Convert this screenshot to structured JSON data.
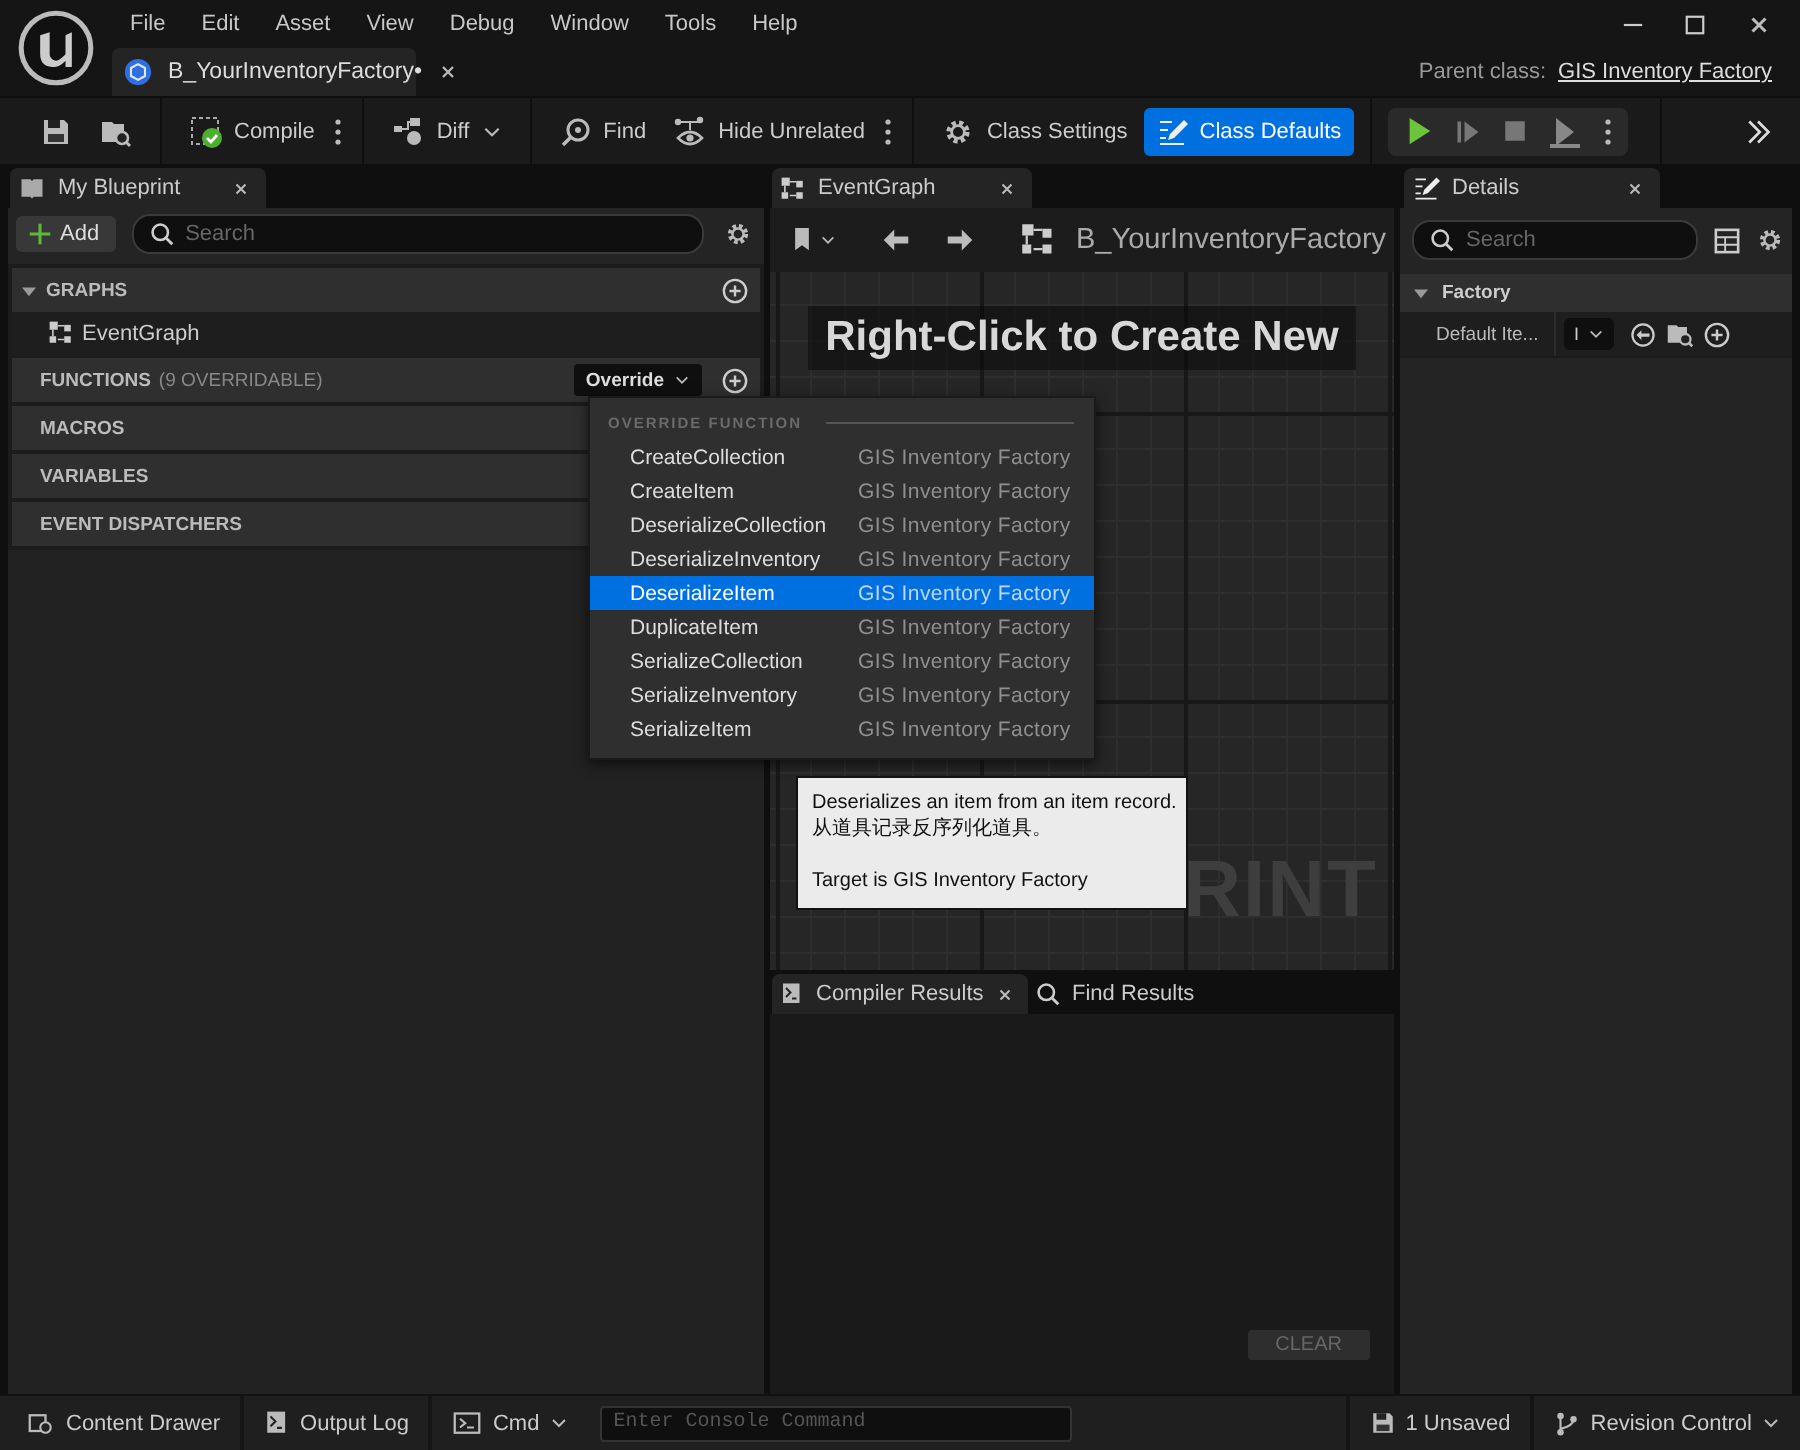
{
  "window": {
    "menu": [
      "File",
      "Edit",
      "Asset",
      "View",
      "Debug",
      "Window",
      "Tools",
      "Help"
    ],
    "document_tab": "B_YourInventoryFactory•",
    "parent_class_label": "Parent class:",
    "parent_class": "GIS Inventory Factory"
  },
  "toolbar": [
    {
      "kind": "compile",
      "label": "Compile",
      "active": false
    },
    {
      "kind": "diff",
      "label": "Diff",
      "active": false
    },
    {
      "kind": "find",
      "label": "Find",
      "active": false
    },
    {
      "kind": "hide",
      "label": "Hide Unrelated",
      "active": false
    },
    {
      "kind": "settings",
      "label": "Class Settings",
      "active": false
    },
    {
      "kind": "defaults",
      "label": "Class Defaults",
      "active": true
    }
  ],
  "my_blueprint": {
    "title": "My Blueprint",
    "add_label": "Add",
    "search_placeholder": "Search",
    "sections": [
      {
        "title": "GRAPHS",
        "items": [
          "EventGraph"
        ]
      },
      {
        "title": "FUNCTIONS",
        "note": "(9 OVERRIDABLE)",
        "dropdown": "Override"
      },
      {
        "title": "MACROS"
      },
      {
        "title": "VARIABLES"
      },
      {
        "title": "EVENT DISPATCHERS"
      }
    ]
  },
  "graph": {
    "tab": "EventGraph",
    "breadcrumb": "B_YourInventoryFactory",
    "hint": "Right-Click to Create New",
    "watermark": "RINT"
  },
  "results": {
    "tabs": [
      {
        "label": "Compiler Results",
        "selected": true
      },
      {
        "label": "Find Results",
        "selected": false
      }
    ],
    "clear": "CLEAR"
  },
  "details": {
    "title": "Details",
    "search_placeholder": "Search",
    "category": "Factory",
    "property": "Default Ite...",
    "value": "I"
  },
  "override_menu": {
    "heading": "OVERRIDE FUNCTION",
    "items": [
      {
        "name": "CreateCollection",
        "source": "GIS Inventory Factory",
        "selected": false
      },
      {
        "name": "CreateItem",
        "source": "GIS Inventory Factory",
        "selected": false
      },
      {
        "name": "DeserializeCollection",
        "source": "GIS Inventory Factory",
        "selected": false
      },
      {
        "name": "DeserializeInventory",
        "source": "GIS Inventory Factory",
        "selected": false
      },
      {
        "name": "DeserializeItem",
        "source": "GIS Inventory Factory",
        "selected": true
      },
      {
        "name": "DuplicateItem",
        "source": "GIS Inventory Factory",
        "selected": false
      },
      {
        "name": "SerializeCollection",
        "source": "GIS Inventory Factory",
        "selected": false
      },
      {
        "name": "SerializeInventory",
        "source": "GIS Inventory Factory",
        "selected": false
      },
      {
        "name": "SerializeItem",
        "source": "GIS Inventory Factory",
        "selected": false
      }
    ]
  },
  "tooltip": {
    "lines": [
      "Deserializes an item from an item record.",
      "从道具记录反序列化道具。"
    ],
    "target": "Target is GIS Inventory Factory"
  },
  "status_bar": {
    "content_drawer": "Content Drawer",
    "output_log": "Output Log",
    "cmd": "Cmd",
    "console_placeholder": "Enter Console Command",
    "unsaved": "1 Unsaved",
    "revision": "Revision Control"
  }
}
